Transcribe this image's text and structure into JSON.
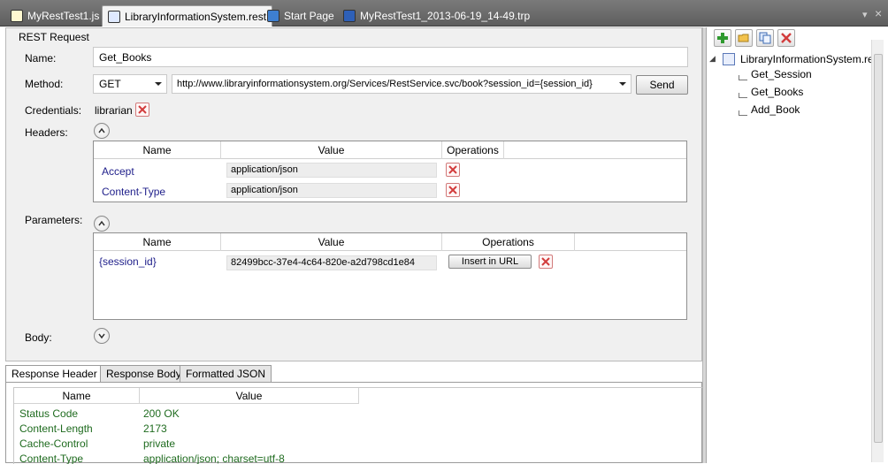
{
  "tabs": [
    {
      "label": "MyRestTest1.js",
      "icon": "js-file-icon",
      "active": false
    },
    {
      "label": "LibraryInformationSystem.rest",
      "icon": "rest-file-icon",
      "active": true
    },
    {
      "label": "Start Page",
      "icon": "start-page-icon",
      "active": false
    },
    {
      "label": "MyRestTest1_2013-06-19_14-49.trp",
      "icon": "trp-file-icon",
      "active": false
    }
  ],
  "tab_controls": {
    "dropdown": "▾",
    "close": "×"
  },
  "request": {
    "section_title": "REST Request",
    "name_label": "Name:",
    "name_value": "Get_Books",
    "method_label": "Method:",
    "method_value": "GET",
    "url_value": "http://www.libraryinformationsystem.org/Services/RestService.svc/book?session_id={session_id}",
    "send_label": "Send",
    "credentials_label": "Credentials:",
    "credentials_value": "librarian",
    "headers_label": "Headers:",
    "parameters_label": "Parameters:",
    "body_label": "Body:"
  },
  "headers_grid": {
    "columns": [
      "Name",
      "Value",
      "Operations"
    ],
    "rows": [
      {
        "name": "Accept",
        "value": "application/json"
      },
      {
        "name": "Content-Type",
        "value": "application/json"
      }
    ]
  },
  "params_grid": {
    "columns": [
      "Name",
      "Value",
      "Operations"
    ],
    "rows": [
      {
        "name": "{session_id}",
        "value": "82499bcc-37e4-4c64-820e-a2d798cd1e84",
        "action": "Insert in URL"
      }
    ]
  },
  "response_tabs": [
    "Response Header",
    "Response Body",
    "Formatted JSON"
  ],
  "response_grid": {
    "columns": [
      "Name",
      "Value"
    ],
    "rows": [
      {
        "name": "Status Code",
        "value": "200 OK"
      },
      {
        "name": "Content-Length",
        "value": "2173"
      },
      {
        "name": "Cache-Control",
        "value": "private"
      },
      {
        "name": "Content-Type",
        "value": "application/json; charset=utf-8"
      }
    ]
  },
  "tree": {
    "root": "LibraryInformationSystem.rest",
    "items": [
      "Get_Session",
      "Get_Books",
      "Add_Book"
    ],
    "expander": "◢"
  },
  "toolbar_icons": [
    "add-icon",
    "open-folder-icon",
    "copy-icon",
    "delete-icon"
  ],
  "colors": {
    "accent_red": "#d23c3c",
    "add_green": "#2f9a2f",
    "response_text": "#1f6b1f"
  }
}
